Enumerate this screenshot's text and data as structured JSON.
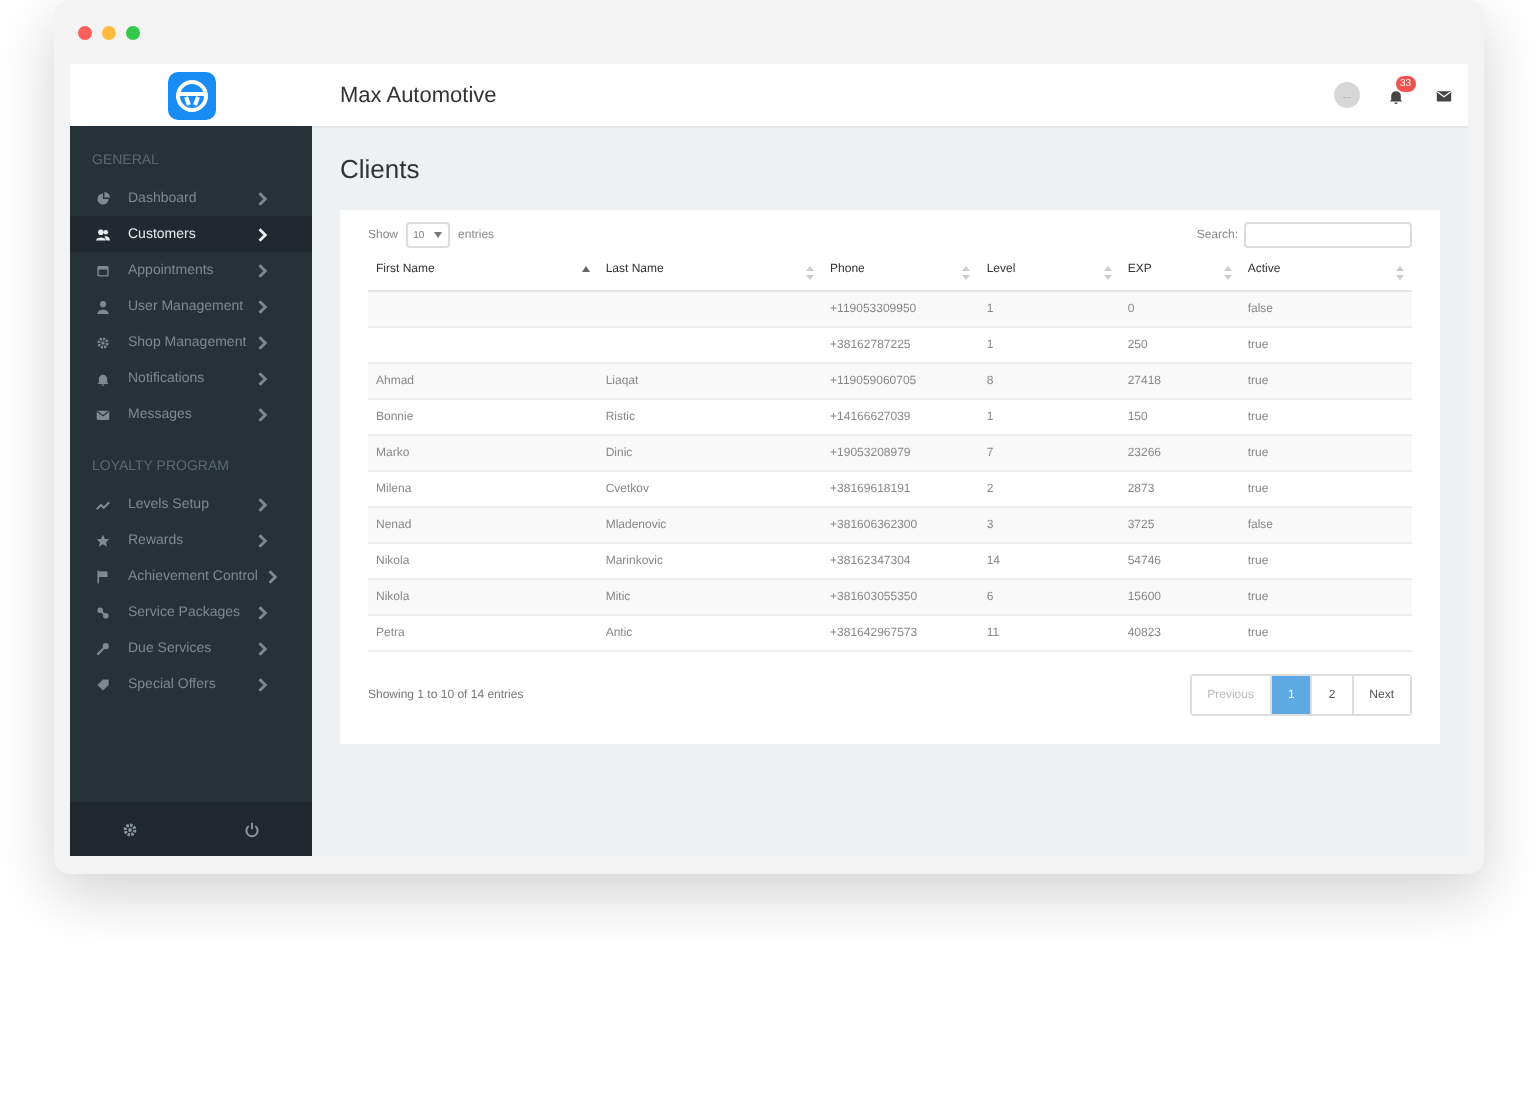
{
  "app": {
    "title": "Max Automotive",
    "notification_count": "33",
    "avatar": "..."
  },
  "sidebar": {
    "sections": [
      {
        "heading": "GENERAL",
        "items": [
          {
            "label": "Dashboard",
            "selected": false
          },
          {
            "label": "Customers",
            "selected": true
          },
          {
            "label": "Appointments",
            "selected": false
          },
          {
            "label": "User Management",
            "selected": false
          },
          {
            "label": "Shop Management",
            "selected": false
          },
          {
            "label": "Notifications",
            "selected": false
          },
          {
            "label": "Messages",
            "selected": false
          }
        ]
      },
      {
        "heading": "LOYALTY PROGRAM",
        "items": [
          {
            "label": "Levels Setup",
            "selected": false
          },
          {
            "label": "Rewards",
            "selected": false
          },
          {
            "label": "Achievement Control",
            "selected": false
          },
          {
            "label": "Service Packages",
            "selected": false
          },
          {
            "label": "Due Services",
            "selected": false
          },
          {
            "label": "Special Offers",
            "selected": false
          }
        ]
      }
    ]
  },
  "page": {
    "title": "Clients"
  },
  "table": {
    "show_label": "Show",
    "page_size": "10",
    "entries_label": "entries",
    "search_label": "Search:",
    "columns": [
      {
        "label": "First Name",
        "sorted": true
      },
      {
        "label": "Last Name",
        "sorted": false
      },
      {
        "label": "Phone",
        "sorted": false
      },
      {
        "label": "Level",
        "sorted": false
      },
      {
        "label": "EXP",
        "sorted": false
      },
      {
        "label": "Active",
        "sorted": false
      }
    ],
    "rows": [
      [
        "",
        "",
        "+119053309950",
        "1",
        "0",
        "false"
      ],
      [
        "",
        "",
        "+38162787225",
        "1",
        "250",
        "true"
      ],
      [
        "Ahmad",
        "Liaqat",
        "+119059060705",
        "8",
        "27418",
        "true"
      ],
      [
        "Bonnie",
        "Ristic",
        "+14166627039",
        "1",
        "150",
        "true"
      ],
      [
        "Marko",
        "Dinic",
        "+19053208979",
        "7",
        "23266",
        "true"
      ],
      [
        "Milena",
        "Cvetkov",
        "+38169618191",
        "2",
        "2873",
        "true"
      ],
      [
        "Nenad",
        "Mladenovic",
        "+381606362300",
        "3",
        "3725",
        "false"
      ],
      [
        "Nikola",
        "Marinkovic",
        "+38162347304",
        "14",
        "54746",
        "true"
      ],
      [
        "Nikola",
        "Mitic",
        "+381603055350",
        "6",
        "15600",
        "true"
      ],
      [
        "Petra",
        "Antic",
        "+381642967573",
        "11",
        "40823",
        "true"
      ]
    ],
    "info": "Showing 1 to 10 of 14 entries",
    "pagination": [
      {
        "label": "Previous",
        "disabled": true,
        "selected": false
      },
      {
        "label": "1",
        "disabled": false,
        "selected": true
      },
      {
        "label": "2",
        "disabled": false,
        "selected": false
      },
      {
        "label": "Next",
        "disabled": false,
        "selected": false
      }
    ]
  }
}
